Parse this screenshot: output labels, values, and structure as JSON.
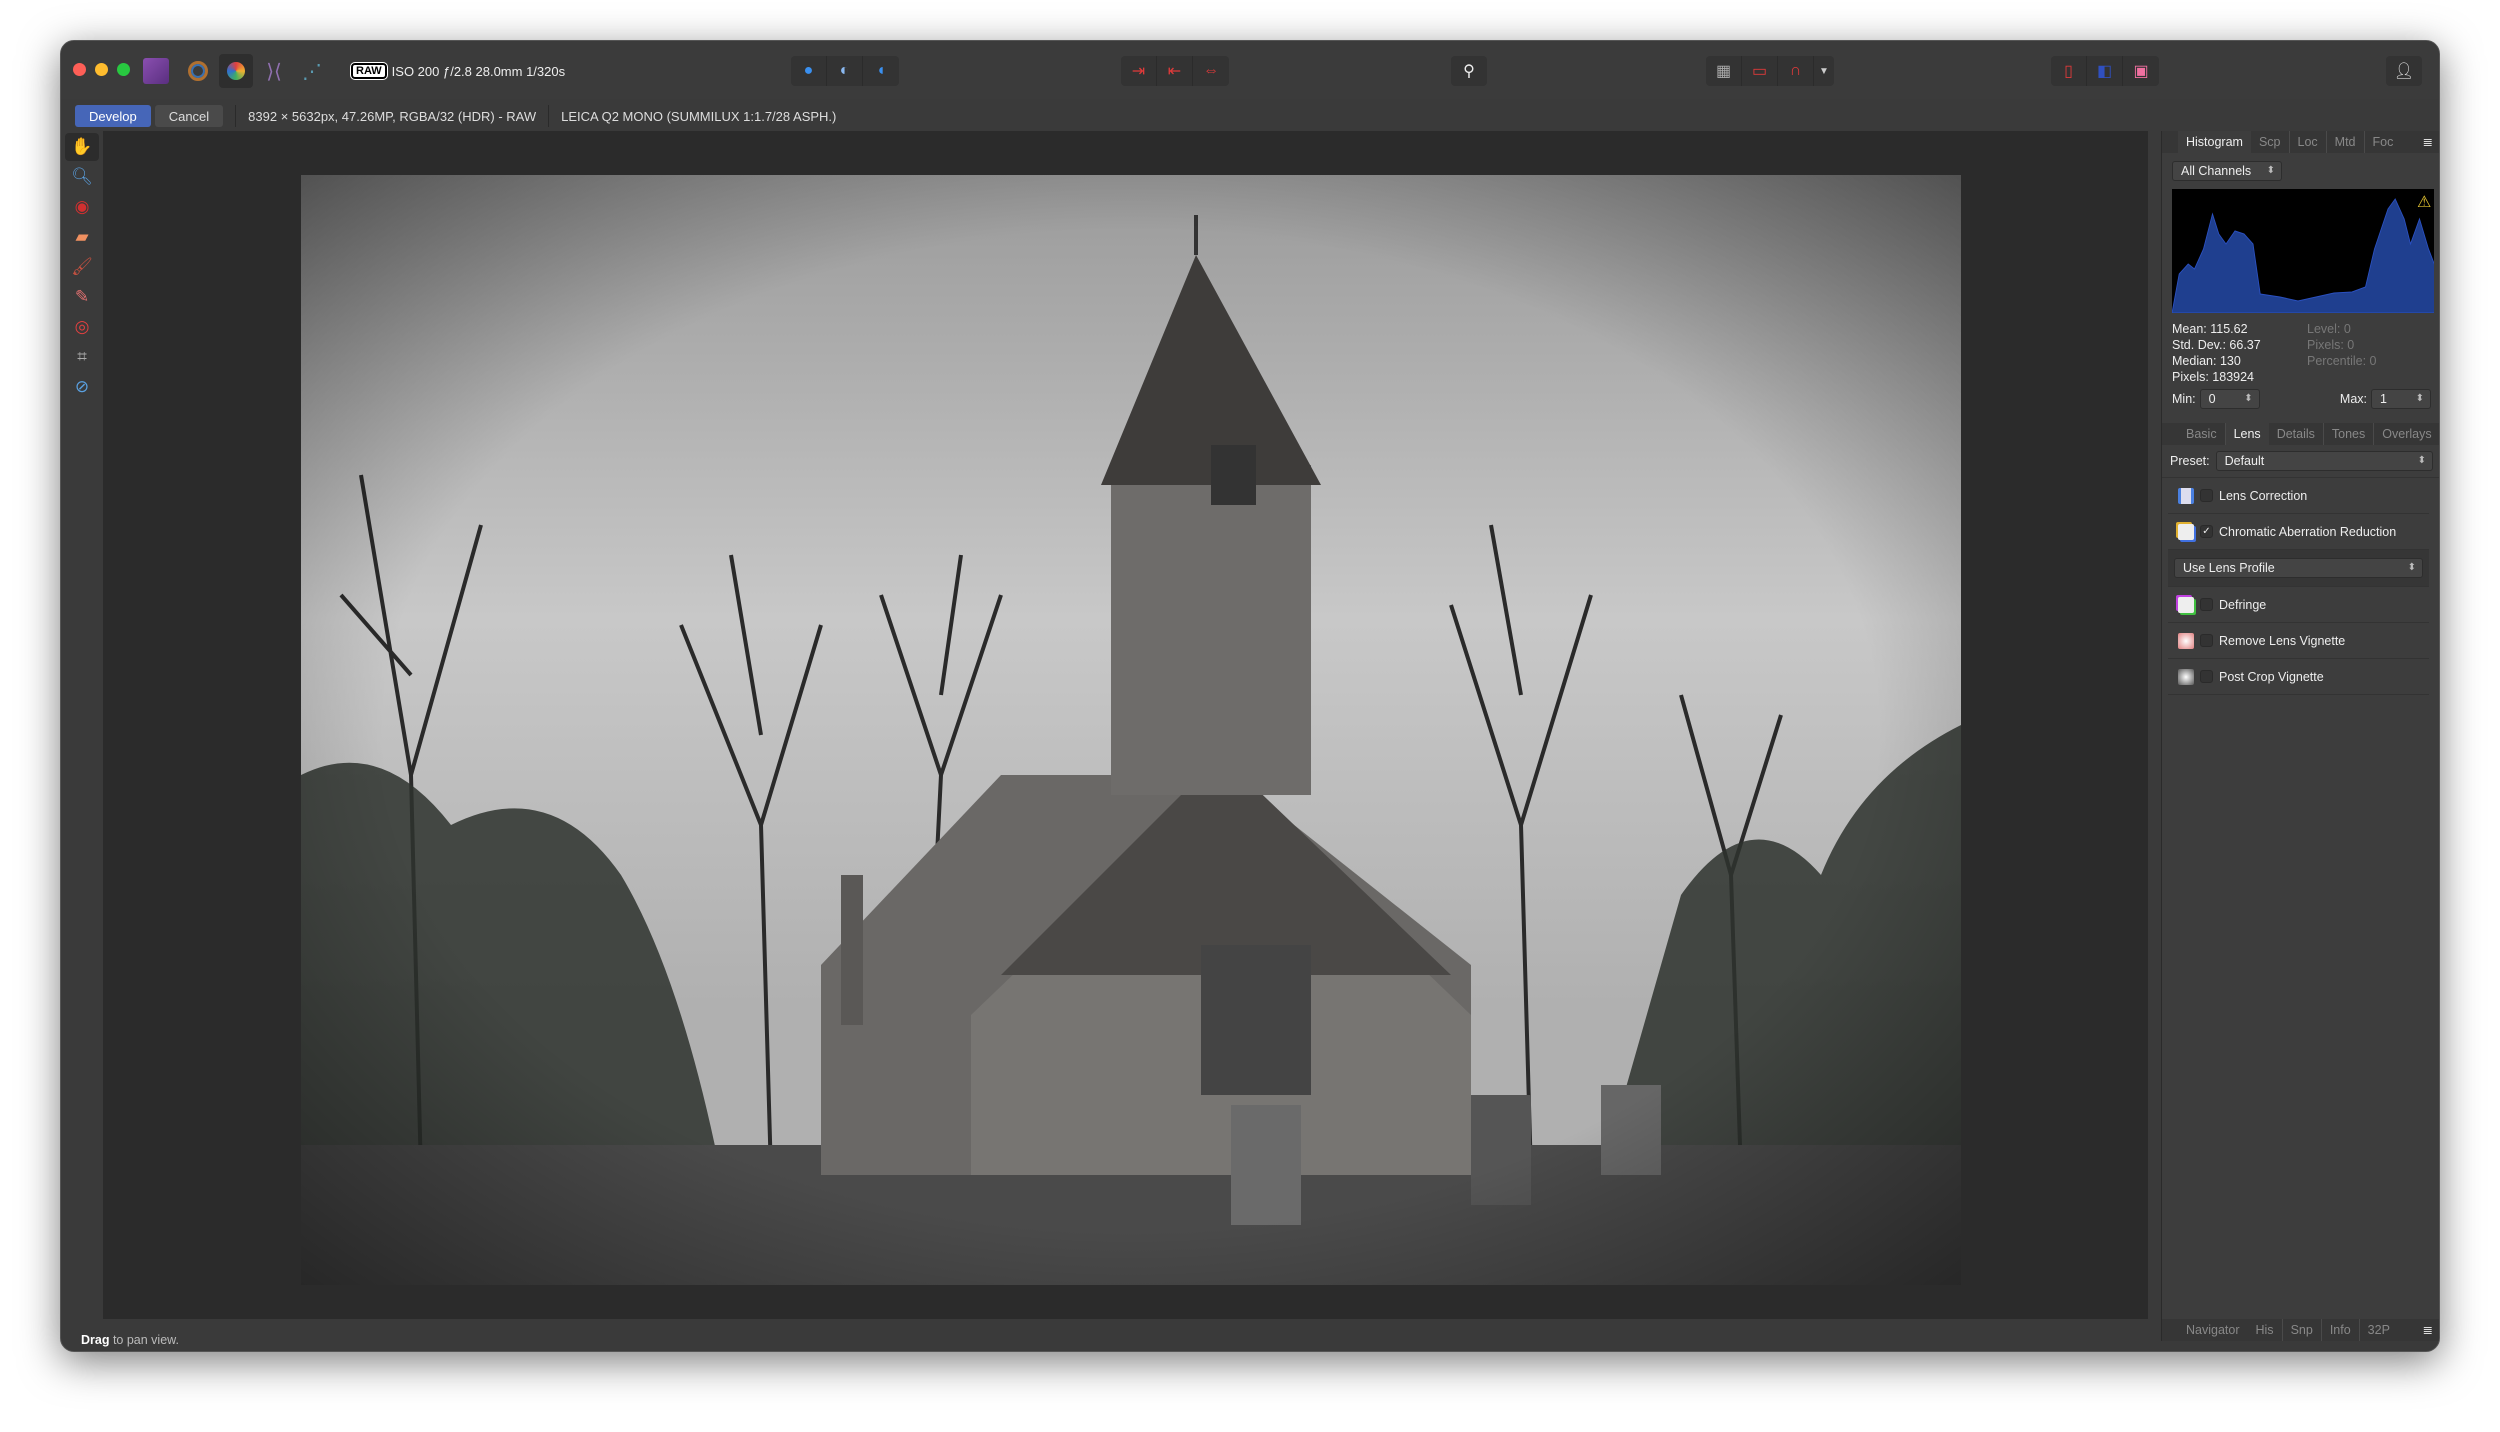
{
  "toolbar": {
    "raw_badge": "RAW",
    "exif": "ISO 200 ƒ/2.8 28.0mm 1/320s",
    "icons": [
      "affinity-photo-logo",
      "develop-persona-icon",
      "photo-persona-icon",
      "tone-mapping-persona-icon",
      "export-persona-icon"
    ]
  },
  "context": {
    "develop": "Develop",
    "cancel": "Cancel",
    "image_info": "8392 × 5632px, 47.26MP, RGBA/32 (HDR) - RAW",
    "lens_info": "LEICA Q2 MONO (SUMMILUX 1:1.7/28 ASPH.)"
  },
  "tools": [
    "hand-tool",
    "zoom-tool",
    "red-eye-tool",
    "blemish-removal-tool",
    "overlay-paint-tool",
    "overlay-erase-tool",
    "overlay-gradient-tool",
    "crop-tool",
    "white-balance-tool"
  ],
  "histogram_panel": {
    "tabs": [
      "Histogram",
      "Scp",
      "Loc",
      "Mtd",
      "Foc"
    ],
    "channel": "All Channels",
    "mean": "Mean: 115.62",
    "std": "Std. Dev.: 66.37",
    "median": "Median: 130",
    "pixels": "Pixels: 183924",
    "level": "Level: 0",
    "pixels_sel": "Pixels: 0",
    "percentile": "Percentile: 0",
    "min_label": "Min:",
    "min": "0",
    "max_label": "Max:",
    "max": "1",
    "color": "#1f3f8f"
  },
  "develop_panel": {
    "tabs": [
      "Basic",
      "Lens",
      "Details",
      "Tones",
      "Overlays"
    ],
    "preset_label": "Preset:",
    "preset": "Default",
    "items": [
      {
        "label": "Lens Correction",
        "checked": false
      },
      {
        "label": "Chromatic Aberration Reduction",
        "checked": true
      },
      {
        "label": "Defringe",
        "checked": false
      },
      {
        "label": "Remove Lens Vignette",
        "checked": false
      },
      {
        "label": "Post Crop Vignette",
        "checked": false
      }
    ],
    "ca_mode": "Use Lens Profile",
    "check": "✓"
  },
  "bottom_tabs": [
    "Navigator",
    "His",
    "Snp",
    "Info",
    "32P"
  ],
  "status": {
    "bold": "Drag",
    "rest": " to pan view."
  }
}
